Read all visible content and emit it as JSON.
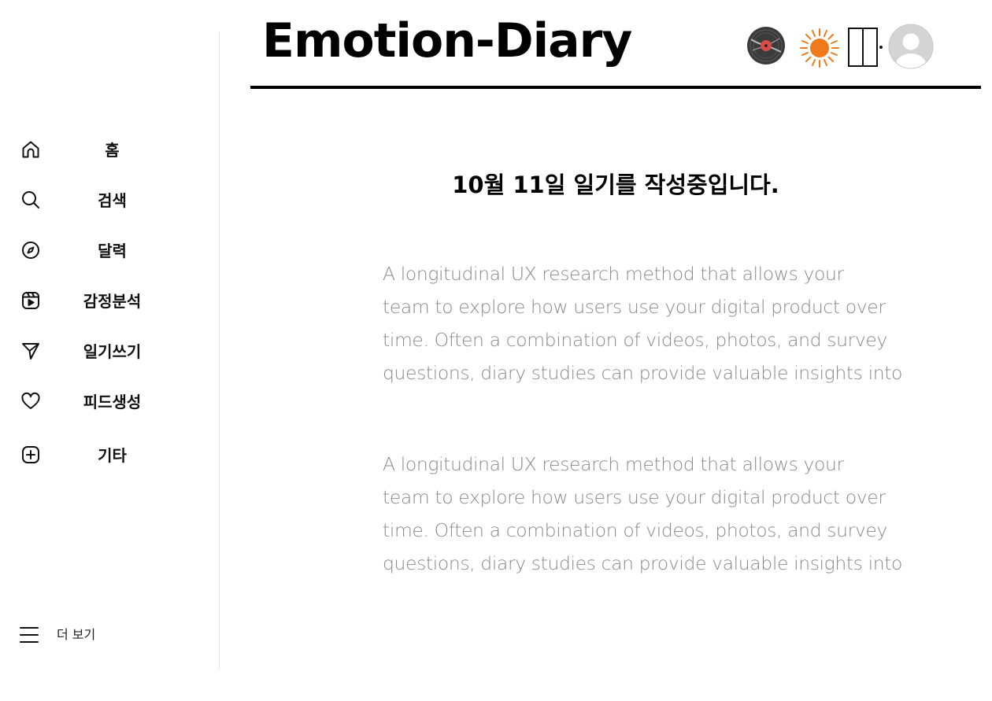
{
  "app": {
    "title": "Emotion-Diary"
  },
  "header": {
    "icons": [
      "vinyl-record-icon",
      "sun-icon",
      "split-panel-icon",
      "profile-avatar-icon"
    ]
  },
  "sidebar": {
    "items": [
      {
        "label": "홈",
        "icon": "home-icon"
      },
      {
        "label": "검색",
        "icon": "search-icon"
      },
      {
        "label": "달력",
        "icon": "compass-icon"
      },
      {
        "label": "감정분석",
        "icon": "video-play-icon"
      },
      {
        "label": "일기쓰기",
        "icon": "send-icon"
      },
      {
        "label": "피드생성",
        "icon": "heart-icon"
      },
      {
        "label": "기타",
        "icon": "plus-square-icon"
      }
    ],
    "more_label": "더 보기",
    "more_icon": "menu-icon"
  },
  "main": {
    "heading": "10월 11일 일기를 작성중입니다.",
    "entries": [
      {
        "lines": [
          "A longitudinal UX research method that allows your",
          "team to  explore how users use your digital product over",
          "time. Often a combination of videos, photos, and survey",
          "questions, diary studies can provide valuable insights into"
        ]
      },
      {
        "lines": [
          "A longitudinal UX research method that allows your",
          "team to  explore how users use your digital product over",
          "time. Often a combination of videos, photos, and survey",
          "questions, diary studies can provide valuable insights into"
        ]
      }
    ]
  },
  "colors": {
    "text_primary": "#000000",
    "text_muted": "#8a8a8a",
    "sun_orange": "#f07a1a",
    "divider": "#e6e6e6"
  }
}
